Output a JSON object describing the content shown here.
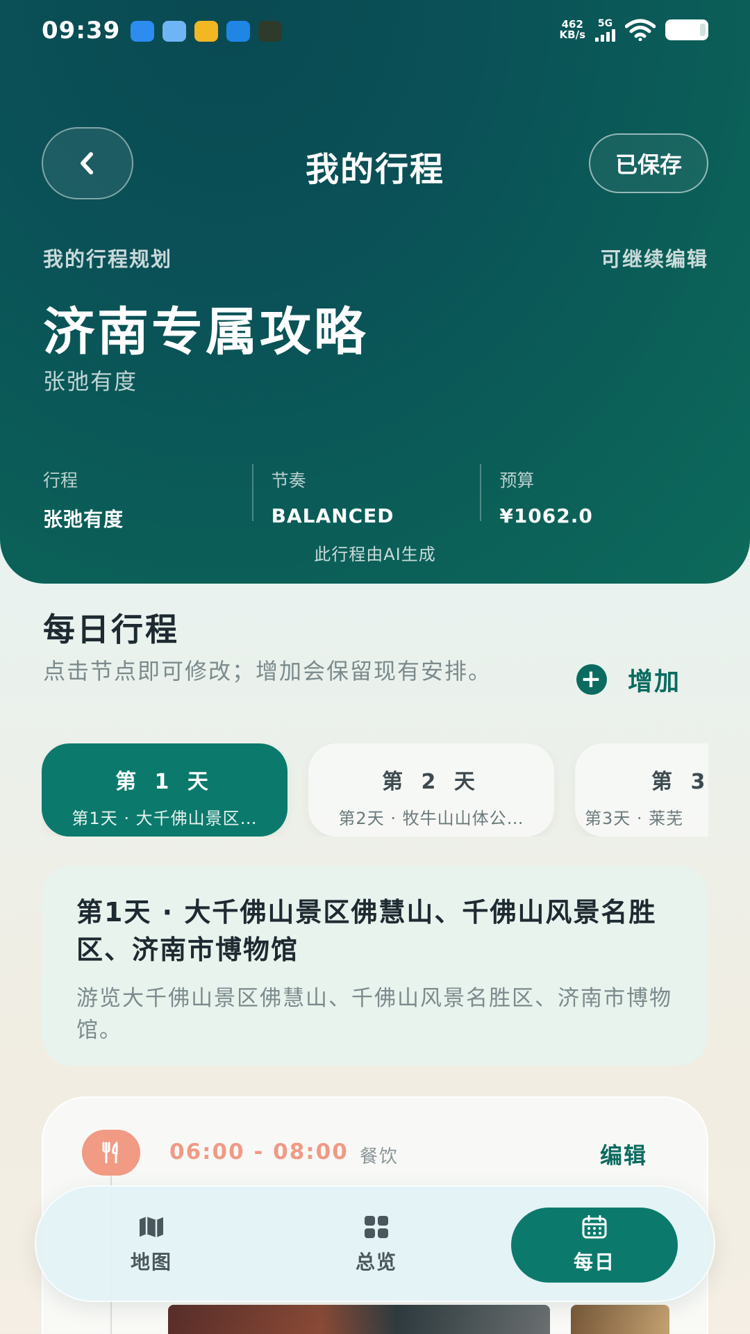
{
  "status_bar": {
    "time": "09:39",
    "speed_value": "462",
    "speed_unit": "KB/s",
    "network": "5G"
  },
  "header": {
    "title": "我的行程",
    "saved_label": "已保存",
    "plan_label": "我的行程规划",
    "editable_label": "可继续编辑",
    "guide_title": "济南专属攻略",
    "guide_subtitle": "张弛有度",
    "stats": [
      {
        "key": "行程",
        "value": "张弛有度"
      },
      {
        "key": "节奏",
        "value": "BALANCED"
      },
      {
        "key": "预算",
        "value": "¥1062.0"
      }
    ],
    "ai_note": "此行程由AI生成"
  },
  "daily": {
    "title": "每日行程",
    "description": "点击节点即可修改；增加会保留现有安排。",
    "add_label": "增加",
    "tabs": [
      {
        "day": "第 1 天",
        "summary": "第1天 · 大千佛山景区…"
      },
      {
        "day": "第 2 天",
        "summary": "第2天 · 牧牛山山体公…"
      },
      {
        "day": "第 3",
        "summary": "第3天 · 莱芜"
      }
    ],
    "active_tab": 0,
    "summary_card": {
      "heading": "第1天 · 大千佛山景区佛慧山、千佛山风景名胜区、济南市博物馆",
      "text": "游览大千佛山景区佛慧山、千佛山风景名胜区、济南市博物馆。"
    },
    "event": {
      "icon": "utensils-icon",
      "time": "06:00 - 08:00",
      "category": "餐饮",
      "edit_label": "编辑"
    }
  },
  "bottom_nav": {
    "items": [
      {
        "label": "地图",
        "icon": "map-icon"
      },
      {
        "label": "总览",
        "icon": "grid-icon"
      },
      {
        "label": "每日",
        "icon": "calendar-icon"
      }
    ],
    "active": 2
  },
  "colors": {
    "header_bg": "#0b5f58",
    "accent": "#0b7a6c",
    "meal_accent": "#f19a84"
  }
}
